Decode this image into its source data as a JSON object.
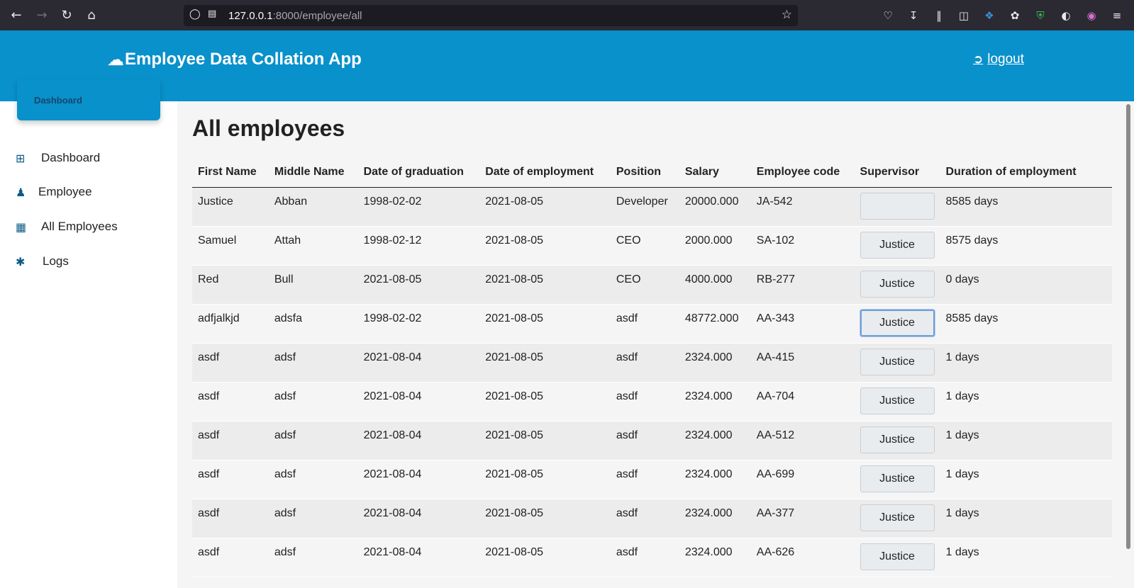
{
  "browser": {
    "url_host": "127.0.0.1",
    "url_path": ":8000/employee/all"
  },
  "header": {
    "brand": "Employee Data Collation App",
    "logout": "logout"
  },
  "sidebar": {
    "card_label": "Dashboard",
    "items": [
      {
        "label": "Dashboard",
        "icon": "windows-icon"
      },
      {
        "label": "Employee",
        "icon": "user-icon"
      },
      {
        "label": "All Employees",
        "icon": "th-large-icon"
      },
      {
        "label": "Logs",
        "icon": "tags-icon"
      }
    ]
  },
  "main": {
    "title": "All employees",
    "columns": [
      "First Name",
      "Middle Name",
      "Date of graduation",
      "Date of employment",
      "Position",
      "Salary",
      "Employee code",
      "Supervisor",
      "Duration of employment"
    ],
    "rows": [
      {
        "first": "Justice",
        "middle": "Abban",
        "grad": "1998-02-02",
        "emp": "2021-08-05",
        "position": "Developer",
        "salary": "20000.000",
        "code": "JA-542",
        "supervisor": "",
        "duration": "8585 days"
      },
      {
        "first": "Samuel",
        "middle": "Attah",
        "grad": "1998-02-12",
        "emp": "2021-08-05",
        "position": "CEO",
        "salary": "2000.000",
        "code": "SA-102",
        "supervisor": "Justice",
        "duration": "8575 days"
      },
      {
        "first": "Red",
        "middle": "Bull",
        "grad": "2021-08-05",
        "emp": "2021-08-05",
        "position": "CEO",
        "salary": "4000.000",
        "code": "RB-277",
        "supervisor": "Justice",
        "duration": "0 days"
      },
      {
        "first": "adfjalkjd",
        "middle": "adsfa",
        "grad": "1998-02-02",
        "emp": "2021-08-05",
        "position": "asdf",
        "salary": "48772.000",
        "code": "AA-343",
        "supervisor": "Justice",
        "duration": "8585 days"
      },
      {
        "first": "asdf",
        "middle": "adsf",
        "grad": "2021-08-04",
        "emp": "2021-08-05",
        "position": "asdf",
        "salary": "2324.000",
        "code": "AA-415",
        "supervisor": "Justice",
        "duration": "1 days"
      },
      {
        "first": "asdf",
        "middle": "adsf",
        "grad": "2021-08-04",
        "emp": "2021-08-05",
        "position": "asdf",
        "salary": "2324.000",
        "code": "AA-704",
        "supervisor": "Justice",
        "duration": "1 days"
      },
      {
        "first": "asdf",
        "middle": "adsf",
        "grad": "2021-08-04",
        "emp": "2021-08-05",
        "position": "asdf",
        "salary": "2324.000",
        "code": "AA-512",
        "supervisor": "Justice",
        "duration": "1 days"
      },
      {
        "first": "asdf",
        "middle": "adsf",
        "grad": "2021-08-04",
        "emp": "2021-08-05",
        "position": "asdf",
        "salary": "2324.000",
        "code": "AA-699",
        "supervisor": "Justice",
        "duration": "1 days"
      },
      {
        "first": "asdf",
        "middle": "adsf",
        "grad": "2021-08-04",
        "emp": "2021-08-05",
        "position": "asdf",
        "salary": "2324.000",
        "code": "AA-377",
        "supervisor": "Justice",
        "duration": "1 days"
      },
      {
        "first": "asdf",
        "middle": "adsf",
        "grad": "2021-08-04",
        "emp": "2021-08-05",
        "position": "asdf",
        "salary": "2324.000",
        "code": "AA-626",
        "supervisor": "Justice",
        "duration": "1 days"
      }
    ]
  },
  "colors": {
    "header_bg": "#0991cb",
    "browser_bg": "#2b2a33"
  }
}
